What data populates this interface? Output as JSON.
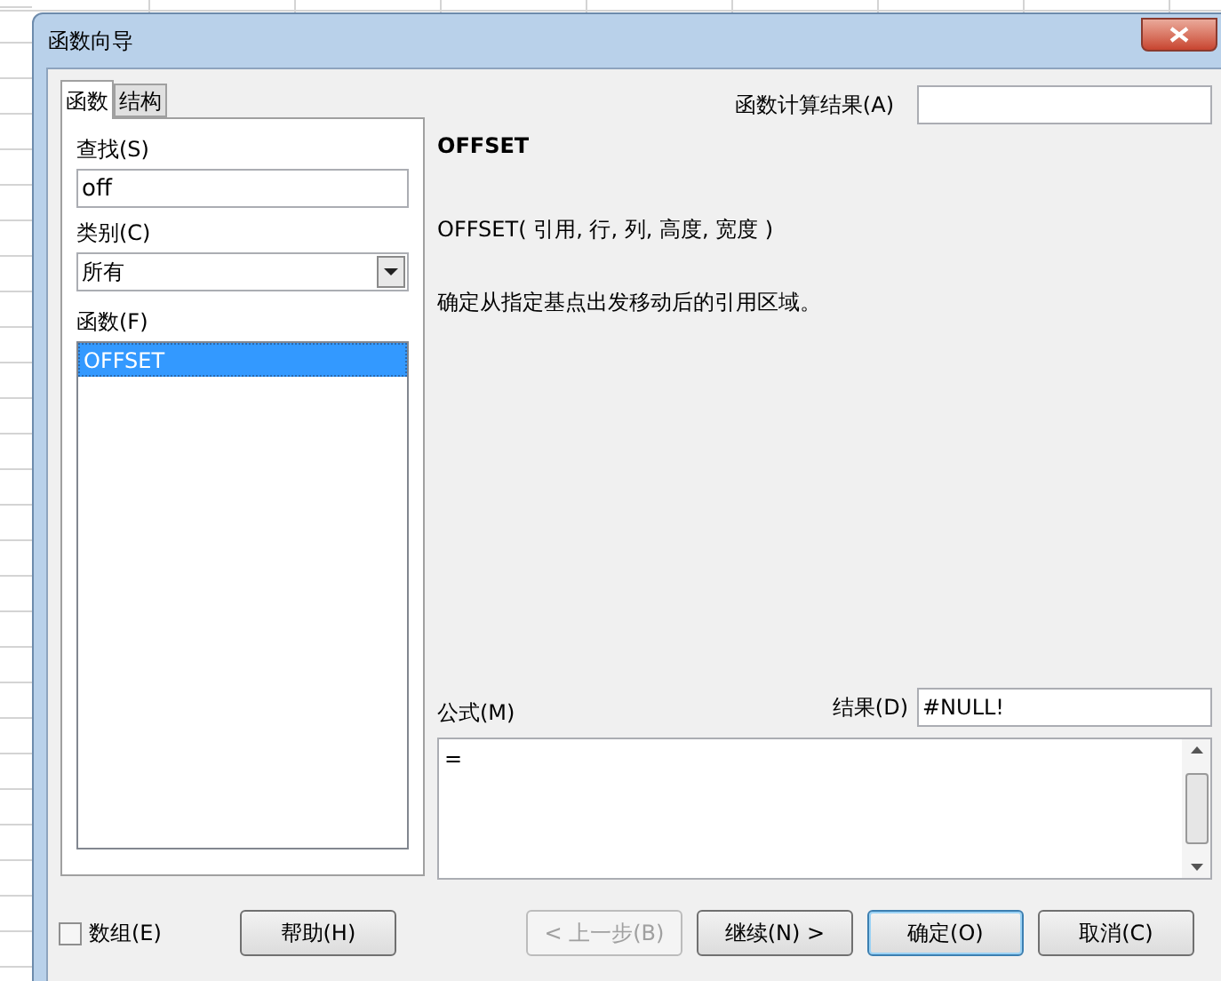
{
  "window": {
    "title": "函数向导"
  },
  "tabs": [
    {
      "label": "函数",
      "selected": true
    },
    {
      "label": "结构",
      "selected": false
    }
  ],
  "search": {
    "label": "查找(S)",
    "value": "off"
  },
  "category": {
    "label": "类别(C)",
    "value": "所有"
  },
  "functions": {
    "label": "函数(F)",
    "items": [
      {
        "label": "OFFSET",
        "selected": true
      }
    ]
  },
  "result_top": {
    "label": "函数计算结果(A)"
  },
  "function_name": "OFFSET",
  "signature": "OFFSET( 引用, 行, 列, 高度, 宽度 )",
  "description": "确定从指定基点出发移动后的引用区域。",
  "formula": {
    "label": "公式(M)",
    "value": "="
  },
  "result": {
    "label": "结果(D)",
    "value": "#NULL!"
  },
  "array": {
    "label": "数组(E)",
    "checked": false
  },
  "buttons": [
    {
      "label": "帮助(H)",
      "disabled": false,
      "default": false
    },
    {
      "label": "< 上一步(B)",
      "disabled": true,
      "default": false
    },
    {
      "label": "继续(N) >",
      "disabled": false,
      "default": false
    },
    {
      "label": "确定(O)",
      "disabled": false,
      "default": true
    },
    {
      "label": "取消(C)",
      "disabled": false,
      "default": false
    }
  ]
}
